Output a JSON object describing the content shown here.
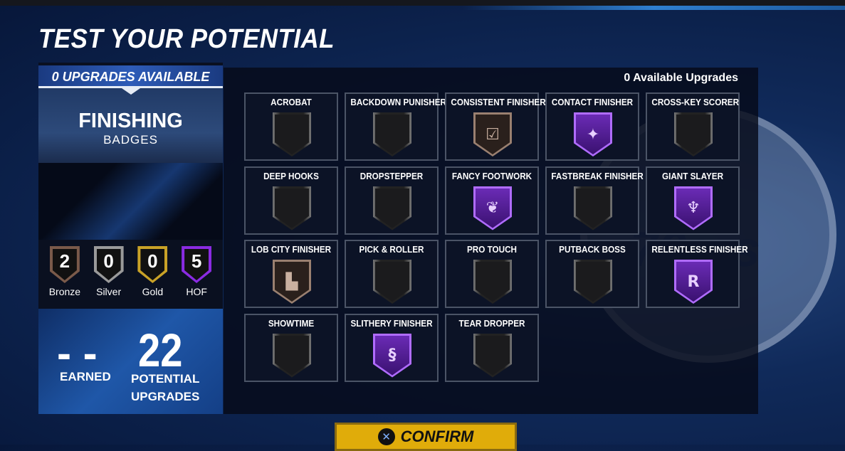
{
  "title": "TEST YOUR POTENTIAL",
  "left": {
    "upgrades_available": "0 UPGRADES AVAILABLE",
    "category": "FINISHING",
    "category_sub": "BADGES",
    "tiers": [
      {
        "label": "Bronze",
        "count": "2",
        "color": "#7a5a4a"
      },
      {
        "label": "Silver",
        "count": "0",
        "color": "#9a9a9a"
      },
      {
        "label": "Gold",
        "count": "0",
        "color": "#c9a227"
      },
      {
        "label": "HOF",
        "count": "5",
        "color": "#8a2be2"
      }
    ],
    "earned_value": "- -",
    "earned_label": "EARNED",
    "potential_value": "22",
    "potential_label": "POTENTIAL UPGRADES"
  },
  "right": {
    "header": "0 Available Upgrades",
    "badges": [
      {
        "name": "ACROBAT",
        "tier": "none",
        "icon": "empty"
      },
      {
        "name": "BACKDOWN PUNISHER",
        "tier": "none",
        "icon": "empty"
      },
      {
        "name": "CONSISTENT FINISHER",
        "tier": "bronze",
        "icon": "checklist"
      },
      {
        "name": "CONTACT FINISHER",
        "tier": "hof",
        "icon": "contact"
      },
      {
        "name": "CROSS-KEY SCORER",
        "tier": "none",
        "icon": "empty"
      },
      {
        "name": "DEEP HOOKS",
        "tier": "none",
        "icon": "empty"
      },
      {
        "name": "DROPSTEPPER",
        "tier": "none",
        "icon": "empty"
      },
      {
        "name": "FANCY FOOTWORK",
        "tier": "hof",
        "icon": "winged-shoe"
      },
      {
        "name": "FASTBREAK FINISHER",
        "tier": "none",
        "icon": "empty"
      },
      {
        "name": "GIANT SLAYER",
        "tier": "hof",
        "icon": "giant"
      },
      {
        "name": "LOB CITY FINISHER",
        "tier": "bronze",
        "icon": "city"
      },
      {
        "name": "PICK & ROLLER",
        "tier": "none",
        "icon": "empty"
      },
      {
        "name": "PRO TOUCH",
        "tier": "none",
        "icon": "empty"
      },
      {
        "name": "PUTBACK BOSS",
        "tier": "none",
        "icon": "empty"
      },
      {
        "name": "RELENTLESS FINISHER",
        "tier": "hof",
        "icon": "r-letter"
      },
      {
        "name": "SHOWTIME",
        "tier": "none",
        "icon": "empty"
      },
      {
        "name": "SLITHERY FINISHER",
        "tier": "hof",
        "icon": "snake"
      },
      {
        "name": "TEAR DROPPER",
        "tier": "none",
        "icon": "empty"
      }
    ]
  },
  "confirm": {
    "button_icon": "cross-button-icon",
    "label": "CONFIRM"
  }
}
